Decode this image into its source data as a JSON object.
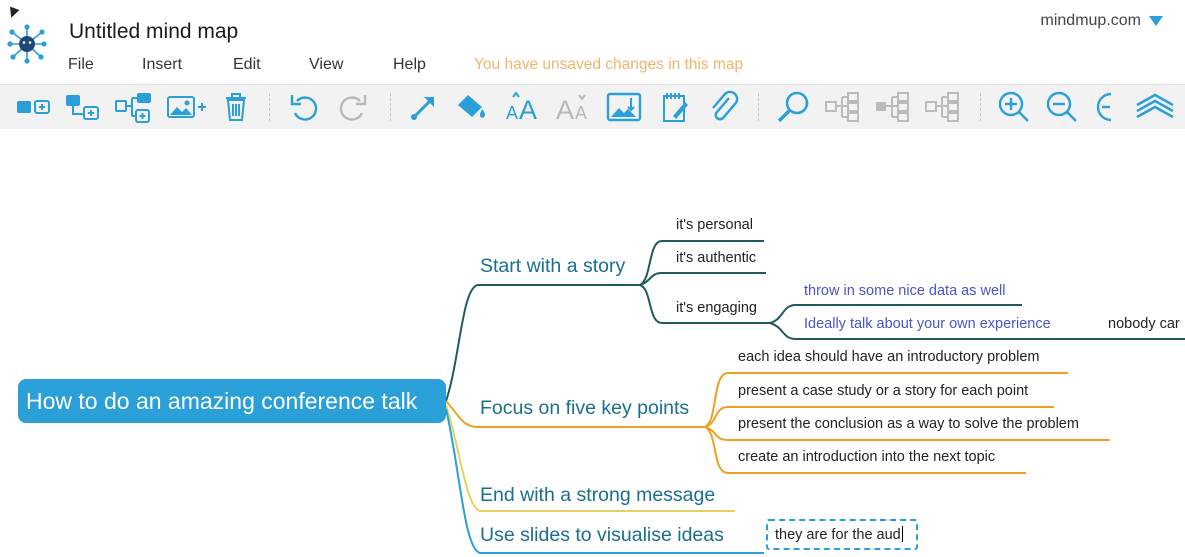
{
  "app": {
    "map_title": "Untitled mind map",
    "brand": "mindmup.com",
    "unsaved_notice": "You have unsaved changes in this map"
  },
  "menu": [
    "File",
    "Insert",
    "Edit",
    "View",
    "Help"
  ],
  "toolbar": {
    "buttons": [
      "add-child-icon",
      "add-sibling-icon",
      "add-group-icon",
      "add-image-icon",
      "delete-icon",
      "undo-icon",
      "redo-icon",
      "connect-icon",
      "fill-color-icon",
      "increase-font-icon",
      "decrease-font-icon",
      "image-icon",
      "note-icon",
      "attachment-icon",
      "search-icon",
      "collapse-map-icon",
      "collapse-node-icon",
      "expand-node-icon",
      "zoom-in-icon",
      "zoom-out-icon",
      "zoom-fit-icon",
      "layers-icon"
    ],
    "accent": "#2a9fd8"
  },
  "mindmap": {
    "root": "How to do an amazing conference talk",
    "branches": [
      {
        "label": "Start with a story",
        "color": "#1f5b5e",
        "children": [
          "it's personal",
          "it's authentic",
          "it's engaging"
        ],
        "engaging_children": [
          "throw in some nice data as well",
          "Ideally talk about your own experience"
        ],
        "overflow_text": "nobody car"
      },
      {
        "label": "Focus on five key points",
        "color": "#f0a020",
        "children": [
          "each idea should have an introductory problem",
          "present a case study or a story for each point",
          "present the conclusion as a way to solve the problem",
          "create an introduction into the next topic"
        ]
      },
      {
        "label": "End with a strong message",
        "color": "#e8d060"
      },
      {
        "label": "Use slides to visualise ideas",
        "color": "#2a9fd8",
        "editing_text": "they are for the aud"
      }
    ]
  }
}
